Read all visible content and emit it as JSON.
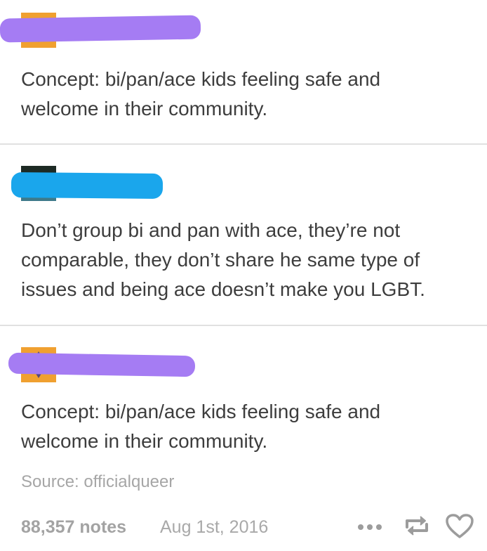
{
  "posts": [
    {
      "body": "Concept: bi/pan/ace kids feeling safe and\nwelcome in their community."
    },
    {
      "body": "Don’t group bi and pan with ace, they’re not\ncomparable, they don’t share he same type of\nissues and being ace doesn’t make you LGBT."
    },
    {
      "body": "Concept: bi/pan/ace kids feeling safe and\nwelcome in their community."
    }
  ],
  "source": {
    "text": "Source: officialqueer"
  },
  "footer": {
    "notes": "88,357 notes",
    "date": "Aug 1st, 2016",
    "icons": [
      "more-icon",
      "reblog-icon",
      "heart-icon"
    ]
  },
  "colors": {
    "redaction_purple": "#a57cf3",
    "redaction_blue": "#1aa6ec",
    "avatar_orange": "#f0a030",
    "divider": "#e1e1e1",
    "text": "#3d3d3d",
    "muted": "#a6a6a6",
    "icon_gray": "#9c9c9c"
  }
}
